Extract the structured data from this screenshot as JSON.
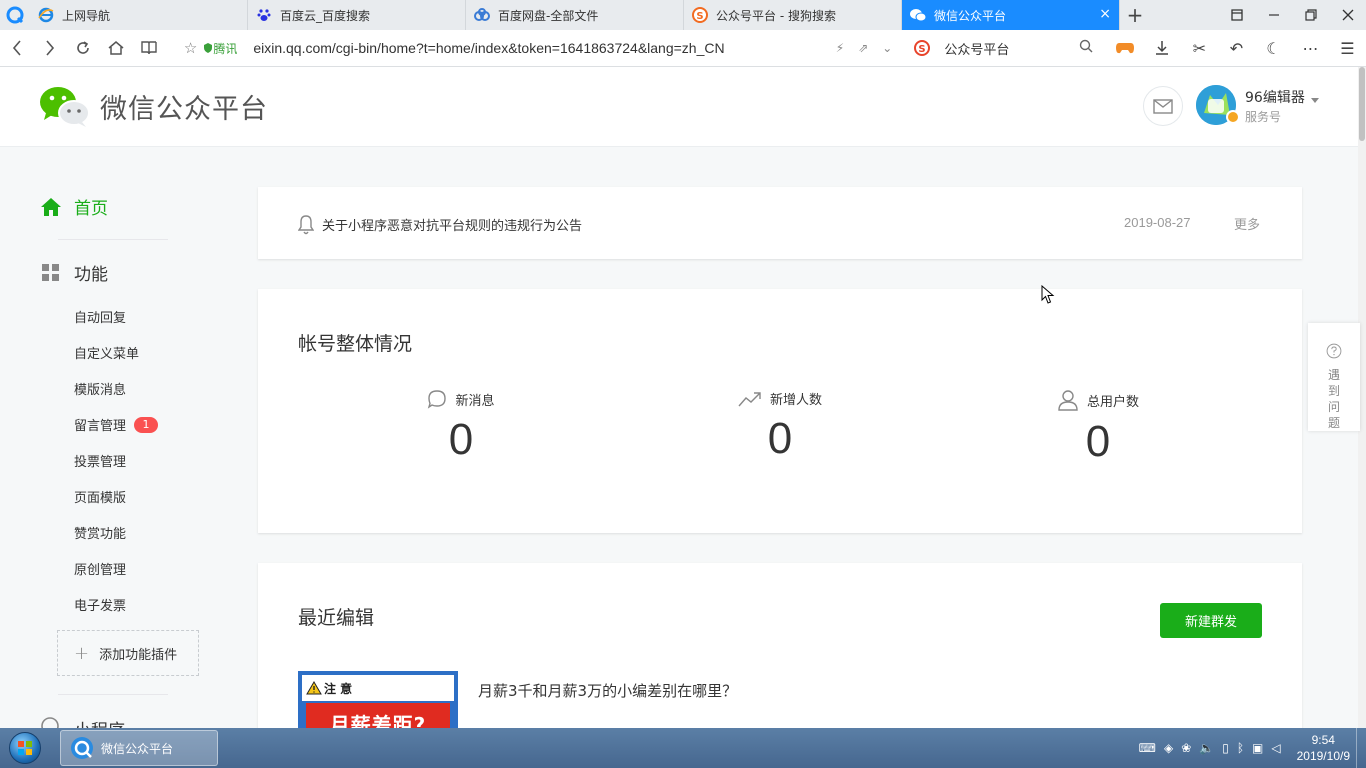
{
  "browser": {
    "tabs": [
      {
        "title": "上网导航"
      },
      {
        "title": "百度云_百度搜索"
      },
      {
        "title": "百度网盘-全部文件"
      },
      {
        "title": "公众号平台 - 搜狗搜索"
      },
      {
        "title": "微信公众平台"
      }
    ],
    "tab_close": "×",
    "new_tab": "+",
    "url_site_label": "腾讯",
    "url": "eixin.qq.com/cgi-bin/home?t=home/index&token=1641863724&lang=zh_CN",
    "search_text": "公众号平台"
  },
  "header": {
    "logo_text": "微信公众平台",
    "account_name": "96编辑器",
    "account_type": "服务号"
  },
  "sidebar": {
    "home": "首页",
    "function": "功能",
    "items": [
      {
        "label": "自动回复"
      },
      {
        "label": "自定义菜单"
      },
      {
        "label": "模版消息"
      },
      {
        "label": "留言管理",
        "badge": "1"
      },
      {
        "label": "投票管理"
      },
      {
        "label": "页面模版"
      },
      {
        "label": "赞赏功能"
      },
      {
        "label": "原创管理"
      },
      {
        "label": "电子发票"
      }
    ],
    "add_plugin": "添加功能插件",
    "mini_program": "小程序"
  },
  "notice": {
    "text": "关于小程序恶意对抗平台规则的违规行为公告",
    "date": "2019-08-27",
    "more": "更多"
  },
  "overview": {
    "title": "帐号整体情况",
    "stats": [
      {
        "label": "新消息",
        "value": "0",
        "icon": "chat-bubble-icon"
      },
      {
        "label": "新增人数",
        "value": "0",
        "icon": "trend-up-icon"
      },
      {
        "label": "总用户数",
        "value": "0",
        "icon": "user-icon"
      }
    ]
  },
  "recent": {
    "title": "最近编辑",
    "new_button": "新建群发",
    "article": {
      "title": "月薪3千和月薪3万的小编差别在哪里？",
      "thumb_warn": "注  意",
      "thumb_headline": "月薪差距?"
    }
  },
  "help": {
    "text": "遇到问题"
  },
  "taskbar": {
    "task_label": "微信公众平台",
    "time": "9:54",
    "date": "2019/10/9"
  },
  "colors": {
    "accent_green": "#1aad19",
    "tab_active": "#1a8cff",
    "badge_red": "#fa5151"
  }
}
